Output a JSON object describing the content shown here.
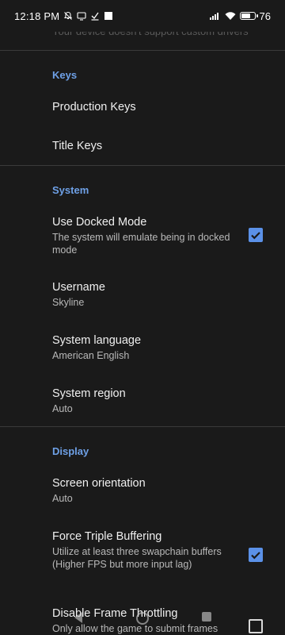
{
  "status_bar": {
    "time": "12:18 PM",
    "battery_percent": "76",
    "battery_level": 0.76,
    "icons": [
      "muted-bell-icon",
      "cast-icon",
      "download-check-icon",
      "square-icon",
      "signal-icon",
      "wifi-icon",
      "battery-icon"
    ]
  },
  "previous_item": {
    "summary": "Your device doesn't support custom drivers"
  },
  "sections": {
    "keys": {
      "header": "Keys",
      "production_keys": {
        "title": "Production Keys"
      },
      "title_keys": {
        "title": "Title Keys"
      }
    },
    "system": {
      "header": "System",
      "docked_mode": {
        "title": "Use Docked Mode",
        "summary": "The system will emulate being in docked mode",
        "checked": true
      },
      "username": {
        "title": "Username",
        "summary": "Skyline"
      },
      "language": {
        "title": "System language",
        "summary": "American English"
      },
      "region": {
        "title": "System region",
        "summary": "Auto"
      }
    },
    "display": {
      "header": "Display",
      "orientation": {
        "title": "Screen orientation",
        "summary": "Auto"
      },
      "triple_buffering": {
        "title": "Force Triple Buffering",
        "summary": "Utilize at least three swapchain buffers (Higher FPS but more input lag)",
        "checked": true
      },
      "frame_throttling": {
        "title": "Disable Frame Throttling",
        "summary": "Only allow the game to submit frames",
        "checked": false
      }
    }
  },
  "colors": {
    "background": "#1a1a1a",
    "accent": "#6ea0e6",
    "checkbox_checked": "#5b91e8"
  },
  "nav_bar": {
    "buttons": [
      "back-icon",
      "home-icon",
      "recents-icon"
    ]
  }
}
